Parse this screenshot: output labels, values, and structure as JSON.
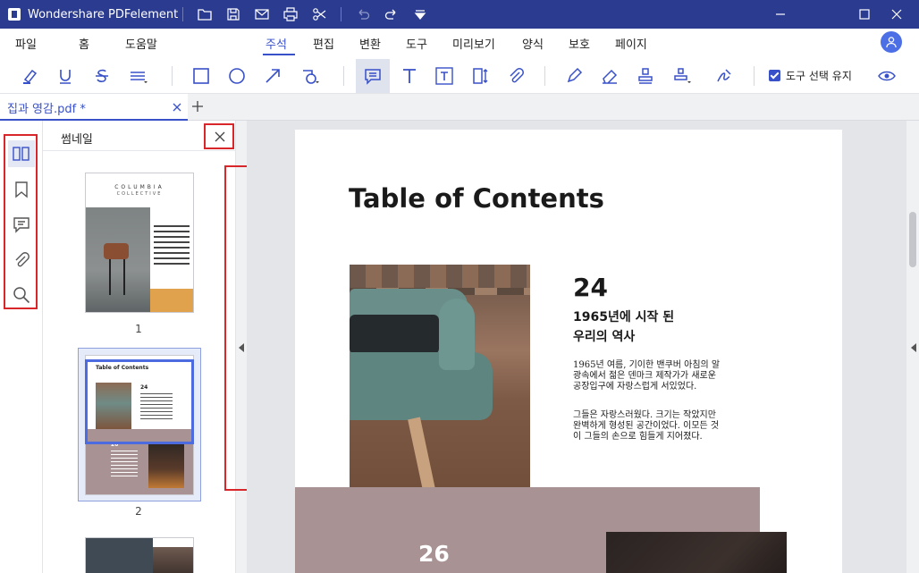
{
  "window": {
    "title": "Wondershare PDFelement",
    "quick_icons": [
      "folder-icon",
      "save-icon",
      "mail-icon",
      "print-icon",
      "scissors-icon",
      "undo-icon",
      "redo-icon",
      "dropdown-icon"
    ]
  },
  "menu": {
    "items": [
      "파일",
      "홈",
      "도움말",
      "주석",
      "편집",
      "변환",
      "도구",
      "미리보기",
      "양식",
      "보호",
      "페이지"
    ],
    "active": "주석"
  },
  "toolbar": {
    "tools": [
      "highlight-icon",
      "underline-icon",
      "strikethrough-icon",
      "line-menu-icon",
      "rectangle-icon",
      "circle-icon",
      "arrow-icon",
      "shape-menu-icon",
      "note-icon",
      "text-icon",
      "text-box-icon",
      "callout-icon",
      "attachment-icon",
      "pencil-icon",
      "eraser-icon",
      "stamp-icon",
      "stamp-menu-icon",
      "signature-icon",
      "eye-icon"
    ],
    "selected_tool": "note-icon",
    "keep_tool_label": "도구 선택 유지",
    "keep_tool_checked": true
  },
  "tabs": [
    {
      "label": "집과 영감.pdf *",
      "active": true
    }
  ],
  "sidebar": {
    "rail": [
      "thumbnails-icon",
      "bookmark-icon",
      "comment-icon",
      "attachment-icon",
      "search-icon"
    ],
    "active": "thumbnails-icon"
  },
  "thumbnail_panel": {
    "title": "썸네일",
    "pages": [
      {
        "number": "1",
        "brand": "COLUMBIA",
        "brand_sub": "COLLECTIVE"
      },
      {
        "number": "2",
        "heading": "Table of Contents",
        "num_a": "24",
        "num_b": "26"
      }
    ]
  },
  "document": {
    "title": "Table of Contents",
    "section_number": "24",
    "section_heading": "1965년에 시작 된 우리의 역사",
    "paragraph_1": "1965년 여름, 기이한 밴쿠버 아침의 알 광속에서 젊은 덴마크 제작가가 새로운 공장입구에 자랑스럽게 서있었다.",
    "paragraph_2": "그들은 자랑스러웠다. 크기는 작았지만 완벽하게 형성된 공간이었다. 이모든 것이 그들의 손으로 힘들게 지어졌다.",
    "band_number": "26"
  },
  "colors": {
    "title_bar": "#2b3b8f",
    "accent": "#3850c8",
    "highlight_box": "#d9262b",
    "band": "#a89293"
  }
}
